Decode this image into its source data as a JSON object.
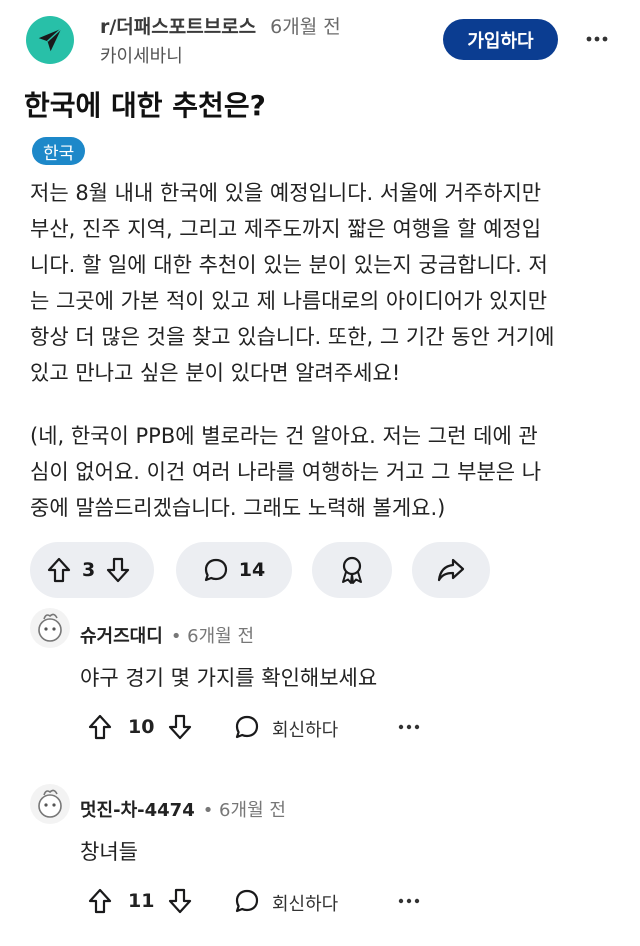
{
  "header": {
    "subreddit": "r/더패스포트브로스",
    "time": "6개월 전",
    "user": "카이세바니",
    "join_label": "가입하다"
  },
  "post": {
    "title": "한국에 대한 추천은?",
    "flair": "한국",
    "paragraph1": [
      "저는 8월 내내 한국에 있을 예정입니다. 서울에 거주하지만",
      "부산, 진주 지역, 그리고 제주도까지 짧은 여행을 할 예정입",
      "니다. 할 일에 대한 추천이 있는 분이 있는지 궁금합니다. 저",
      "는 그곳에 가본 적이 있고 제 나름대로의 아이디어가 있지만",
      "항상 더 많은 것을 찾고 있습니다. 또한, 그 기간 동안 거기에",
      "있고 만나고 싶은 분이 있다면 알려주세요!"
    ],
    "paragraph2": [
      "(네, 한국이 PPB에 별로라는 건 알아요. 저는 그런 데에 관",
      "심이 없어요. 이건 여러 나라를 여행하는 거고 그 부분은 나",
      "중에 말씀드리겠습니다. 그래도 노력해 볼게요.)"
    ],
    "votes": "3",
    "comments": "14"
  },
  "comments": [
    {
      "author": "슈거즈대디",
      "time": "• 6개월 전",
      "text": "야구 경기 몇 가지를 확인해보세요",
      "votes": "10",
      "reply_label": "회신하다"
    },
    {
      "author": "멋진-차-4474",
      "time": "• 6개월 전",
      "text": "창녀들",
      "votes": "11",
      "reply_label": "회신하다"
    }
  ],
  "icons": {
    "subreddit": "airplane-icon",
    "more": "more-horizontal-icon",
    "upvote": "upvote-arrow-icon",
    "downvote": "downvote-arrow-icon",
    "comment": "comment-bubble-icon",
    "award": "award-icon",
    "share": "share-arrow-icon",
    "reply": "reply-bubble-icon"
  },
  "colors": {
    "accent": "#0b3d91",
    "flair": "#1d88c9",
    "subreddit_icon": "#28c0a8",
    "pill_bg": "#eceef2"
  }
}
